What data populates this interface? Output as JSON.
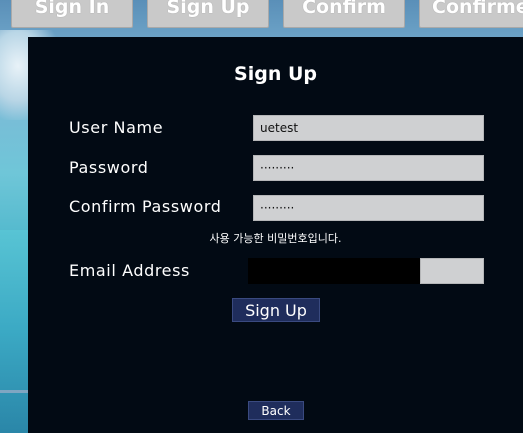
{
  "tabs": [
    {
      "label": "Sign In"
    },
    {
      "label": "Sign Up"
    },
    {
      "label": "Confirm"
    },
    {
      "label": "Confirmed"
    }
  ],
  "form": {
    "title": "Sign Up",
    "username_label": "User Name",
    "username_value": "uetest",
    "password_label": "Password",
    "password_value": "·········",
    "confirm_label": "Confirm Password",
    "confirm_value": "·········",
    "password_hint": "사용 가능한 비밀번호입니다.",
    "email_label": "Email Address",
    "submit_label": "Sign Up",
    "back_label": "Back"
  }
}
